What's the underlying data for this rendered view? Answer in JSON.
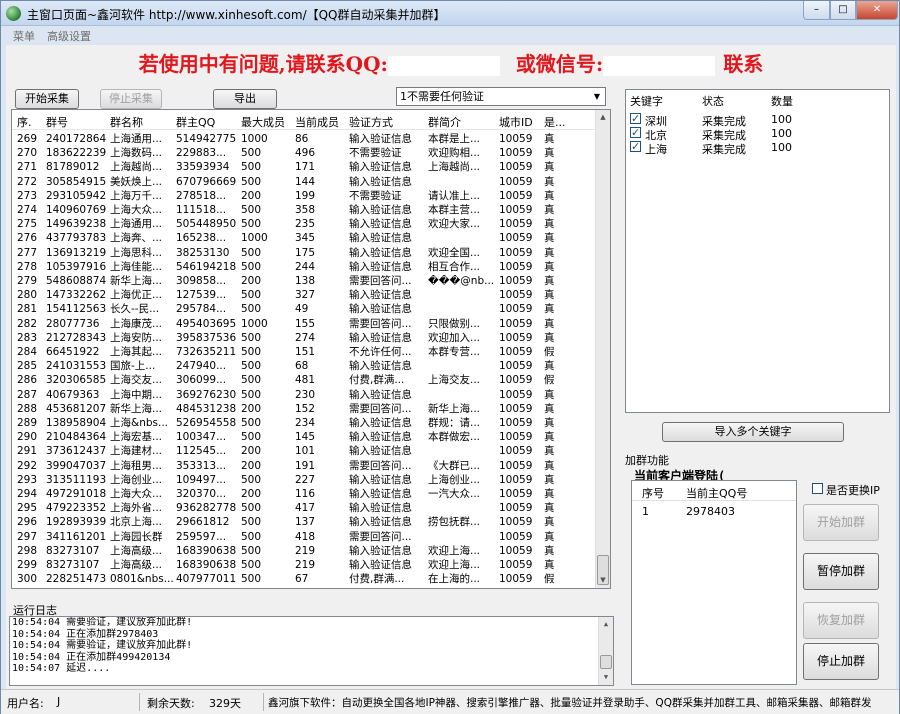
{
  "window": {
    "title": "主窗口页面~鑫河软件 http://www.xinhesoft.com/【QQ群自动采集并加群】",
    "min_glyph": "–",
    "max_glyph": "□",
    "close_glyph": "✕"
  },
  "menu": [
    "菜单",
    "高级设置"
  ],
  "banner": {
    "part1": "若使用中有问题,请联系QQ:",
    "part2": "或微信号:",
    "part3": "联系"
  },
  "toolbar": {
    "start_label": "开始采集",
    "stop_label": "停止采集",
    "export_label": "导出",
    "verify_option": "1不需要任何验证"
  },
  "groups": {
    "columns": [
      "序.",
      "群号",
      "群名称",
      "群主QQ",
      "最大成员",
      "当前成员",
      "验证方式",
      "群简介",
      "城市ID",
      "是..."
    ],
    "rows": [
      [
        "269",
        "240172864",
        "上海通用...",
        "514942775",
        "1000",
        "86",
        "输入验证信息",
        "本群是上...",
        "10059",
        "真"
      ],
      [
        "270",
        "183622239",
        "上海数码...",
        "229883...",
        "500",
        "496",
        "不需要验证",
        "欢迎购相...",
        "10059",
        "真"
      ],
      [
        "271",
        "81789012",
        "上海越尚...",
        "33593934",
        "500",
        "171",
        "输入验证信息",
        "上海越尚...",
        "10059",
        "真"
      ],
      [
        "272",
        "305854915",
        "美妖焕上...",
        "670796669",
        "500",
        "144",
        "输入验证信息",
        "",
        "10059",
        "真"
      ],
      [
        "273",
        "293105942",
        "上海万千...",
        "278518...",
        "200",
        "199",
        "不需要验证",
        "请认准上...",
        "10059",
        "真"
      ],
      [
        "274",
        "140960769",
        "上海大众...",
        "111518...",
        "500",
        "358",
        "输入验证信息",
        "本群主营...",
        "10059",
        "真"
      ],
      [
        "275",
        "149639238",
        "上海通用...",
        "505448950",
        "500",
        "235",
        "输入验证信息",
        "欢迎大家...",
        "10059",
        "真"
      ],
      [
        "276",
        "437793783",
        "上海奔、...",
        "165238...",
        "1000",
        "345",
        "输入验证信息",
        "",
        "10059",
        "真"
      ],
      [
        "277",
        "136913219",
        "上海思科...",
        "38253130",
        "500",
        "175",
        "输入验证信息",
        "欢迎全国...",
        "10059",
        "真"
      ],
      [
        "278",
        "105397916",
        "上海佳能...",
        "546194218",
        "500",
        "244",
        "输入验证信息",
        "相互合作...",
        "10059",
        "真"
      ],
      [
        "279",
        "548608874",
        "新华上海...",
        "309858...",
        "200",
        "138",
        "需要回答问...",
        "���@nb...",
        "10059",
        "真"
      ],
      [
        "280",
        "147332262",
        "上海优正...",
        "127539...",
        "500",
        "327",
        "输入验证信息",
        "",
        "10059",
        "真"
      ],
      [
        "281",
        "154112563",
        "长久--民...",
        "295784...",
        "500",
        "49",
        "输入验证信息",
        "",
        "10059",
        "真"
      ],
      [
        "282",
        "28077736",
        "上海康茂...",
        "495403695",
        "1000",
        "155",
        "需要回答问...",
        "只限做别...",
        "10059",
        "真"
      ],
      [
        "283",
        "212728343",
        "上海安防...",
        "395837536",
        "500",
        "274",
        "输入验证信息",
        "欢迎加入...",
        "10059",
        "真"
      ],
      [
        "284",
        "66451922",
        "上海其起...",
        "732635211",
        "500",
        "151",
        "不允许任何...",
        "本群专营...",
        "10059",
        "假"
      ],
      [
        "285",
        "241031553",
        "国旅-上...",
        "247940...",
        "500",
        "68",
        "输入验证信息",
        "",
        "10059",
        "真"
      ],
      [
        "286",
        "320306585",
        "上海交友...",
        "306099...",
        "500",
        "481",
        "付费,群满...",
        "上海交友...",
        "10059",
        "假"
      ],
      [
        "287",
        "40679363",
        "上海中期...",
        "369276230",
        "500",
        "230",
        "输入验证信息",
        "",
        "10059",
        "真"
      ],
      [
        "288",
        "453681207",
        "新华上海...",
        "484531238",
        "200",
        "152",
        "需要回答问...",
        "新华上海...",
        "10059",
        "真"
      ],
      [
        "289",
        "138958904",
        "上海&nbs...",
        "526954558",
        "500",
        "234",
        "输入验证信息",
        "群规：请...",
        "10059",
        "真"
      ],
      [
        "290",
        "210484364",
        "上海宏基...",
        "100347...",
        "500",
        "145",
        "输入验证信息",
        "本群做宏...",
        "10059",
        "真"
      ],
      [
        "291",
        "373612437",
        "上海建材...",
        "112545...",
        "200",
        "101",
        "输入验证信息",
        "",
        "10059",
        "真"
      ],
      [
        "292",
        "399047037",
        "上海租男...",
        "353313...",
        "200",
        "191",
        "需要回答问...",
        "《大群已...",
        "10059",
        "真"
      ],
      [
        "293",
        "313511193",
        "上海创业...",
        "109497...",
        "500",
        "227",
        "输入验证信息",
        "上海创业...",
        "10059",
        "真"
      ],
      [
        "294",
        "497291018",
        "上海大众...",
        "320370...",
        "200",
        "116",
        "输入验证信息",
        "一汽大众...",
        "10059",
        "真"
      ],
      [
        "295",
        "479223352",
        "上海外省...",
        "936282778",
        "500",
        "417",
        "输入验证信息",
        "",
        "10059",
        "真"
      ],
      [
        "296",
        "192893939",
        "北京上海...",
        "29661812",
        "500",
        "137",
        "输入验证信息",
        "捞包抚群...",
        "10059",
        "真"
      ],
      [
        "297",
        "341161201",
        "上海园长群",
        "259597...",
        "500",
        "418",
        "需要回答问...",
        "",
        "10059",
        "真"
      ],
      [
        "298",
        "83273107",
        "上海高级...",
        "168390638",
        "500",
        "219",
        "输入验证信息",
        "欢迎上海...",
        "10059",
        "真"
      ],
      [
        "299",
        "83273107",
        "上海高级...",
        "168390638",
        "500",
        "219",
        "输入验证信息",
        "欢迎上海...",
        "10059",
        "真"
      ],
      [
        "300",
        "228251473",
        "0801&nbs...",
        "407977011",
        "500",
        "67",
        "付费,群满...",
        "在上海的...",
        "10059",
        "假"
      ]
    ]
  },
  "log": {
    "title": "运行日志",
    "lines": [
      "10:54:04 需要验证，建议放弃加此群!",
      "10:54:04 正在添加群2978403",
      "10:54:04 需要验证，建议放弃加此群!",
      "10:54:04 正在添加群499420134",
      "10:54:07 延迟...."
    ]
  },
  "keywords": {
    "columns": [
      "关键字",
      "状态",
      "数量"
    ],
    "rows": [
      {
        "name": "深圳",
        "status": "采集完成",
        "count": "100",
        "checked": true
      },
      {
        "name": "北京",
        "status": "采集完成",
        "count": "100",
        "checked": true
      },
      {
        "name": "上海",
        "status": "采集完成",
        "count": "100",
        "checked": true
      }
    ],
    "import_label": "导入多个关键字"
  },
  "join": {
    "section_label": "加群功能",
    "current_client_label": "当前客户端登陆(",
    "columns": [
      "序号",
      "当前主QQ号"
    ],
    "rows": [
      [
        "1",
        "2978403"
      ]
    ],
    "change_ip_label": "是否更换IP",
    "start_label": "开始加群",
    "pause_label": "暂停加群",
    "resume_label": "恢复加群",
    "stop_label": "停止加群"
  },
  "status": {
    "user_label": "用户名:",
    "user_value": "J",
    "days_label": "剩余天数:",
    "days_value": "329天",
    "ad": "鑫河旗下软件：自动更换全国各地IP神器、搜索引擎推广器、批量验证并登录助手、QQ群采集并加群工具、邮箱采集器、邮箱群发"
  }
}
